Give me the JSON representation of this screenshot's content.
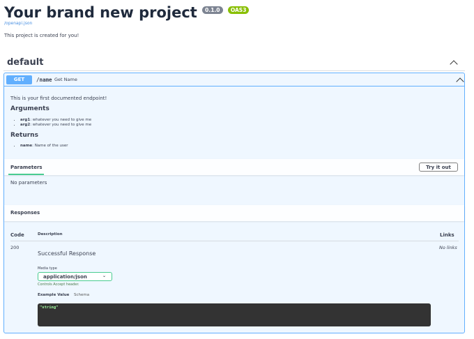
{
  "info": {
    "title": "Your brand new project",
    "version": "0.1.0",
    "oas": "OAS3",
    "spec_link": "/openapi.json",
    "description": "This project is created for you!"
  },
  "tag": {
    "name": "default"
  },
  "operation": {
    "method": "GET",
    "path": "/name",
    "summary": "Get Name",
    "description": "This is your first documented endpoint!",
    "arguments_heading": "Arguments",
    "arguments": [
      {
        "name": "arg1",
        "text": ": whatever you need to give me"
      },
      {
        "name": "arg2",
        "text": ": whatever you need to give me"
      }
    ],
    "returns_heading": "Returns",
    "returns": [
      {
        "name": "name",
        "text": ": Name of the user"
      }
    ]
  },
  "parameters": {
    "tab": "Parameters",
    "try_button": "Try it out",
    "empty": "No parameters"
  },
  "responses": {
    "heading": "Responses",
    "col_code": "Code",
    "col_description": "Description",
    "col_links": "Links",
    "rows": [
      {
        "code": "200",
        "description": "Successful Response",
        "links": "No links",
        "media_type_label": "Media type",
        "media_type": "application/json",
        "media_hint": "Controls Accept header.",
        "example_tab": "Example Value",
        "schema_tab": "Schema",
        "example": "\"string\""
      }
    ]
  },
  "colors": {
    "get": "#61affe",
    "version_badge": "#7d8492",
    "oas_badge": "#89bf04"
  }
}
